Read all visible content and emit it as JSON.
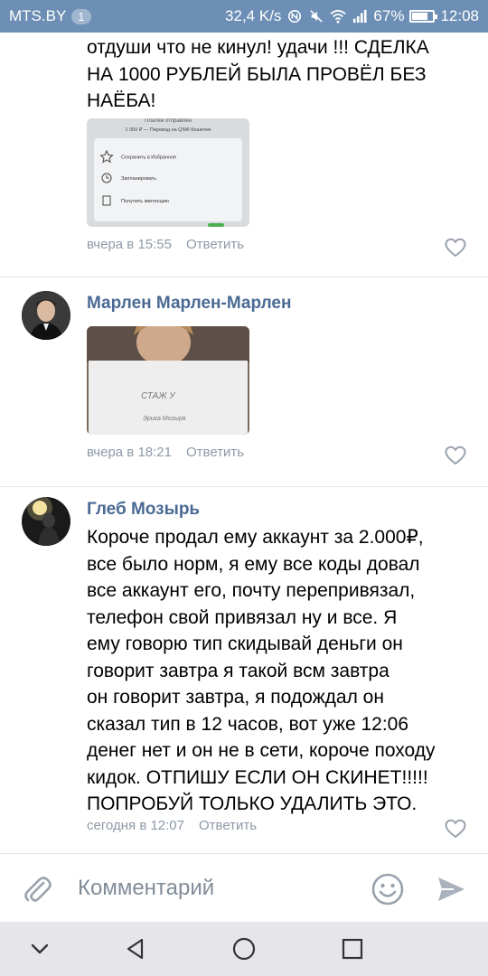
{
  "status_bar": {
    "carrier": "MTS.BY",
    "badge": "1",
    "speed": "32,4 K/s",
    "battery_percent": "67%",
    "battery_level": 0.67,
    "time": "12:08",
    "icons": [
      "nfc-icon",
      "mute-icon",
      "wifi-icon",
      "signal-icon",
      "battery-icon"
    ]
  },
  "comments": [
    {
      "text_lines": [
        "отдуши что не кинул! удачи !!! СДЕЛКА",
        "НА 1000 РУБЛЕЙ БЫЛА ПРОВЁЛ БЕЗ",
        "НАЁБА!"
      ],
      "attachment": {
        "header_line1": "Платёж отправлен",
        "header_line2": "1 050 ₽ — Перевод на QIWI Кошелек",
        "options": [
          "Сохранить в Избранное",
          "Запланировать",
          "Получить квитанцию"
        ]
      },
      "time": "вчера в 15:55",
      "reply": "Ответить"
    },
    {
      "author": "Марлен Марлен-Марлен",
      "attachment": {
        "paper_line1": "СТАЖ У",
        "paper_line2": "Эрика Мозыря"
      },
      "time": "вчера в 18:21",
      "reply": "Ответить"
    },
    {
      "author": "Глеб Мозырь",
      "text_lines": [
        "Короче продал ему аккаунт за 2.000₽,",
        "все было норм, я ему все коды довал",
        "все аккаунт его, почту перепривязал,",
        "телефон свой привязал ну и все. Я",
        "ему говорю тип скидывай деньги он",
        "говорит завтра я такой всм завтра",
        "он говорит завтра, я подождал он",
        "сказал тип в 12 часов, вот уже 12:06",
        "денег нет и он не в сети, короче походу",
        "кидок. ОТПИШУ ЕСЛИ ОН СКИНЕТ!!!!!",
        "ПОПРОБУЙ ТОЛЬКО УДАЛИТЬ ЭТО."
      ],
      "time": "сегодня в 12:07",
      "reply": "Ответить"
    }
  ],
  "composer": {
    "placeholder": "Комментарий"
  },
  "colors": {
    "status_bar": "#6d8fb5",
    "author": "#4a6a93",
    "meta": "#8d99a6",
    "icon_gray": "#99a2ad"
  }
}
